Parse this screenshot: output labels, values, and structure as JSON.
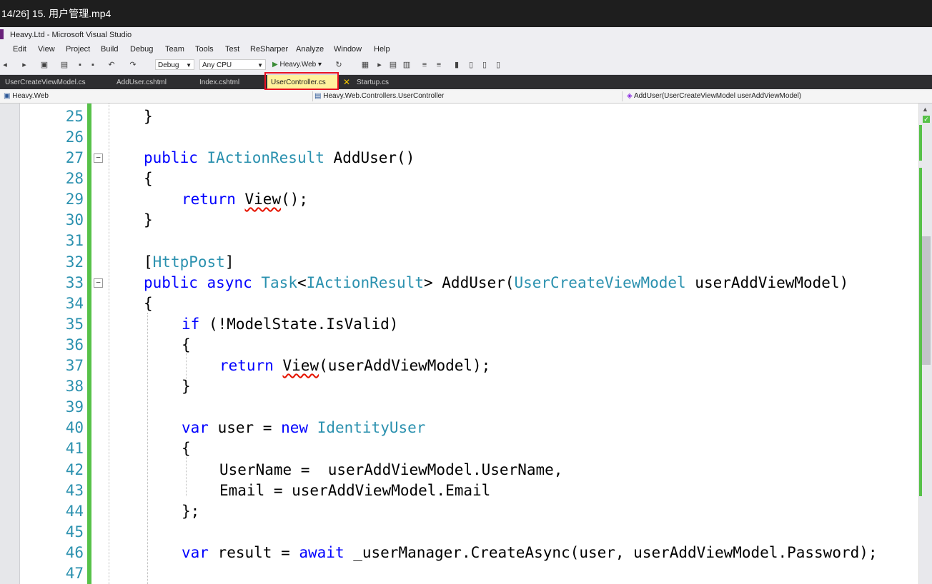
{
  "player": {
    "title": "14/26] 15. 用户管理.mp4"
  },
  "window": {
    "title": "Heavy.Ltd - Microsoft Visual Studio"
  },
  "menu": [
    "Edit",
    "View",
    "Project",
    "Build",
    "Debug",
    "Team",
    "Tools",
    "Test",
    "ReSharper",
    "Analyze",
    "Window",
    "Help"
  ],
  "toolbar": {
    "config": "Debug",
    "platform": "Any CPU",
    "run_target": "Heavy.Web"
  },
  "tabs": [
    {
      "label": "UserCreateViewModel.cs"
    },
    {
      "label": "AddUser.cshtml"
    },
    {
      "label": "Index.cshtml"
    },
    {
      "label": "UserController.cs",
      "active": true
    },
    {
      "label": "Startup.cs"
    }
  ],
  "navbar": {
    "project": "Heavy.Web",
    "class": "Heavy.Web.Controllers.UserController",
    "member": "AddUser(UserCreateViewModel userAddViewModel)"
  },
  "line_numbers": [
    "25",
    "26",
    "27",
    "28",
    "29",
    "30",
    "31",
    "32",
    "33",
    "34",
    "35",
    "36",
    "37",
    "38",
    "39",
    "40",
    "41",
    "42",
    "43",
    "44",
    "45",
    "46",
    "47"
  ],
  "code": {
    "l25": "}",
    "l27_kw": "public",
    "l27_ty": "IActionResult",
    "l27_rest": "AddUser()",
    "l28": "{",
    "l29_kw": "return",
    "l29_sq": "View",
    "l29_rest": "();",
    "l30": "}",
    "l32_open": "[",
    "l32_ty": "HttpPost",
    "l32_close": "]",
    "l33_kw1": "public",
    "l33_kw2": "async",
    "l33_ty1": "Task",
    "l33_lt": "<",
    "l33_ty2": "IActionResult",
    "l33_mid": "> AddUser(",
    "l33_ty3": "UserCreateViewModel",
    "l33_rest": " userAddViewModel)",
    "l34": "{",
    "l35_kw": "if",
    "l35_rest": " (!ModelState.IsValid)",
    "l36": "{",
    "l37_kw": "return",
    "l37_sq": "View",
    "l37_rest": "(userAddViewModel);",
    "l38": "}",
    "l40_kw1": "var",
    "l40_mid": " user = ",
    "l40_kw2": "new",
    "l40_ty": "IdentityUser",
    "l41": "{",
    "l42": "UserName =  userAddViewModel.UserName,",
    "l43": "Email = userAddViewModel.Email",
    "l44": "};",
    "l46_kw1": "var",
    "l46_mid": " result = ",
    "l46_kw2": "await",
    "l46_rest": " _userManager.CreateAsync(user, userAddViewModel.Password);"
  }
}
